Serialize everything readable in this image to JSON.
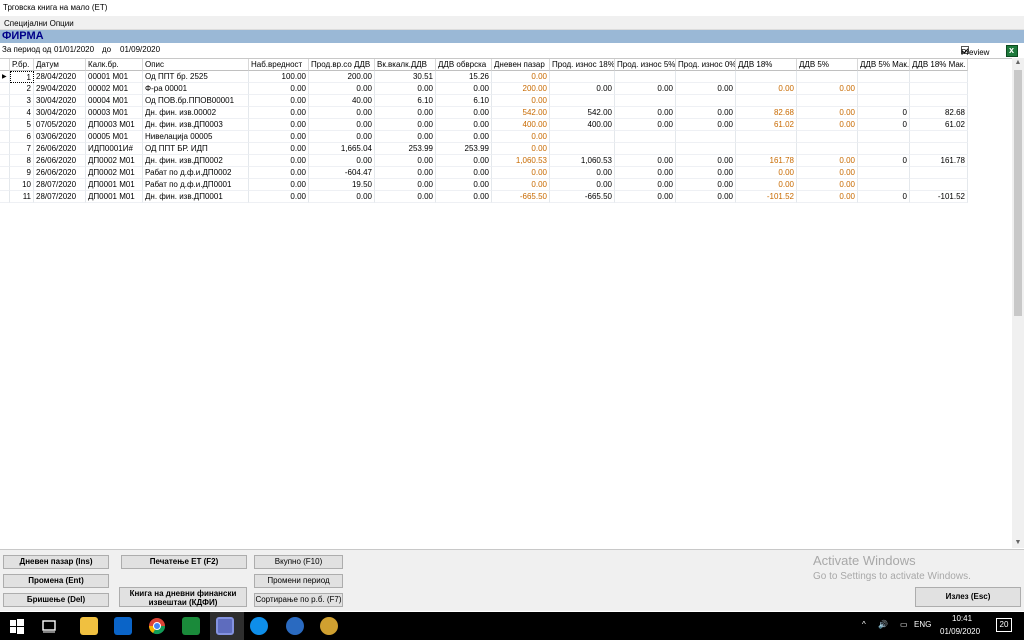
{
  "window": {
    "title": "Трговска книга на мало (ЕТ)"
  },
  "menu": {
    "items": [
      "Специјални Опции"
    ]
  },
  "company": {
    "name": "ФИРМА"
  },
  "period": {
    "label": "За период од",
    "from": "01/01/2020",
    "to_label": "до",
    "to": "01/09/2020"
  },
  "preview": {
    "label": "Preview",
    "checked": true
  },
  "table": {
    "columns": [
      "Р.бр.",
      "Датум",
      "Калк.бр.",
      "Опис",
      "Наб.вредност",
      "Прод.вр.со ДДВ",
      "Вк.вкалк.ДДВ",
      "ДДВ обврска",
      "Дневен пазар",
      "Прод. износ 18%",
      "Прод. износ 5%",
      "Прод. износ 0%",
      "ДДВ 18%",
      "ДДВ 5%",
      "ДДВ 5% Мак.",
      "ДДВ 18% Мак."
    ],
    "rows": [
      [
        "1",
        "28/04/2020",
        "00001  М01",
        "Од ППТ бр. 2525",
        "100.00",
        "200.00",
        "30.51",
        "15.26",
        "0.00",
        "",
        "",
        "",
        "",
        "",
        "",
        ""
      ],
      [
        "2",
        "29/04/2020",
        "00002  М01",
        "Ф-ра 00001",
        "0.00",
        "0.00",
        "0.00",
        "0.00",
        "200.00",
        "0.00",
        "0.00",
        "0.00",
        "0.00",
        "0.00",
        "",
        ""
      ],
      [
        "3",
        "30/04/2020",
        "00004  М01",
        "Од ПОВ.бр.ППОВ00001",
        "0.00",
        "40.00",
        "6.10",
        "6.10",
        "0.00",
        "",
        "",
        "",
        "",
        "",
        "",
        ""
      ],
      [
        "4",
        "30/04/2020",
        "00003  М01",
        "Дн. фин. изв.00002",
        "0.00",
        "0.00",
        "0.00",
        "0.00",
        "542.00",
        "542.00",
        "0.00",
        "0.00",
        "82.68",
        "0.00",
        "0",
        "82.68"
      ],
      [
        "5",
        "07/05/2020",
        "ДП0003 М01",
        "Дн. фин. изв.ДП0003",
        "0.00",
        "0.00",
        "0.00",
        "0.00",
        "400.00",
        "400.00",
        "0.00",
        "0.00",
        "61.02",
        "0.00",
        "0",
        "61.02"
      ],
      [
        "6",
        "03/06/2020",
        "00005  М01",
        "Нивелација 00005",
        "0.00",
        "0.00",
        "0.00",
        "0.00",
        "0.00",
        "",
        "",
        "",
        "",
        "",
        "",
        ""
      ],
      [
        "7",
        "26/06/2020",
        "ИДП0001И#",
        "ОД ППТ БР. ИДП",
        "0.00",
        "1,665.04",
        "253.99",
        "253.99",
        "0.00",
        "",
        "",
        "",
        "",
        "",
        "",
        ""
      ],
      [
        "8",
        "26/06/2020",
        "ДП0002 М01",
        "Дн. фин. изв.ДП0002",
        "0.00",
        "0.00",
        "0.00",
        "0.00",
        "1,060.53",
        "1,060.53",
        "0.00",
        "0.00",
        "161.78",
        "0.00",
        "0",
        "161.78"
      ],
      [
        "9",
        "26/06/2020",
        "ДП0002 М01",
        "Рабат по д.ф.и.ДП0002",
        "0.00",
        "-604.47",
        "0.00",
        "0.00",
        "0.00",
        "0.00",
        "0.00",
        "0.00",
        "0.00",
        "0.00",
        "",
        ""
      ],
      [
        "10",
        "28/07/2020",
        "ДП0001 М01",
        "Рабат по д.ф.и.ДП0001",
        "0.00",
        "19.50",
        "0.00",
        "0.00",
        "0.00",
        "0.00",
        "0.00",
        "0.00",
        "0.00",
        "0.00",
        "",
        ""
      ],
      [
        "11",
        "28/07/2020",
        "ДП0001 М01",
        "Дн. фин. изв.ДП0001",
        "0.00",
        "0.00",
        "0.00",
        "0.00",
        "-665.50",
        "-665.50",
        "0.00",
        "0.00",
        "-101.52",
        "0.00",
        "0",
        "-101.52"
      ]
    ]
  },
  "buttons": {
    "daily_market": "Дневен пазар (Ins)",
    "change": "Промена (Ent)",
    "delete": "Бришење (Del)",
    "print": "Печатење ЕТ (F2)",
    "book_line1": "Книга на дневни финански",
    "book_line2": "извештаи (КДФИ)",
    "total": "Вкупно (F10)",
    "change_period": "Промени период",
    "sort": "Сортирање по р.б. (F7)",
    "exit": "Излез (Esc)"
  },
  "watermark": {
    "line1": "Activate Windows",
    "line2": "Go to Settings to activate Windows."
  },
  "taskbar": {
    "icons": [
      "windows-start-icon",
      "search-icon",
      "task-view-icon",
      "file-explorer-icon",
      "outlook-icon",
      "chrome-icon",
      "app-icon",
      "helix-app-icon",
      "teamviewer-icon",
      "app-blue-icon",
      "paint-icon"
    ],
    "lang": "ENG",
    "time": "10:41",
    "date": "01/09/2020",
    "notifications": "20"
  },
  "colors": {
    "header_bar": "#9ab8d6",
    "company_text": "#00008a",
    "orange_values": "#c86a00"
  }
}
